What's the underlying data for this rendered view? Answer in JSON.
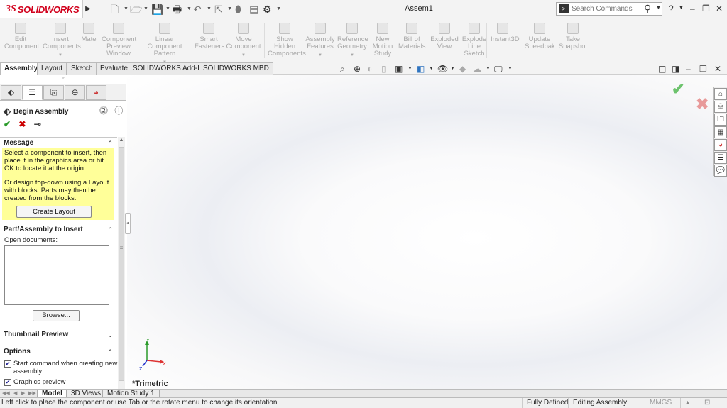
{
  "app": {
    "brand_mark": "3S",
    "brand_name": "SOLIDWORKS",
    "document_title": "Assem1"
  },
  "title_bar": {
    "search_placeholder": "Search Commands",
    "help_label": "?",
    "minimize_label": "–",
    "restore_label": "❐",
    "close_label": "✕"
  },
  "ribbon": {
    "commands": [
      {
        "id": "edit-component",
        "label": "Edit Component",
        "lines": [
          "Edit",
          "Component"
        ],
        "has_dropdown": false
      },
      {
        "id": "insert-components",
        "label": "Insert Components",
        "lines": [
          "Insert",
          "Components"
        ],
        "has_dropdown": true
      },
      {
        "id": "mate",
        "label": "Mate",
        "lines": [
          "Mate"
        ],
        "has_dropdown": false
      },
      {
        "id": "component-preview-window",
        "label": "Component Preview Window",
        "lines": [
          "Component",
          "Preview",
          "Window"
        ],
        "has_dropdown": false
      },
      {
        "id": "linear-component-pattern",
        "label": "Linear Component Pattern",
        "lines": [
          "Linear Component",
          "Pattern"
        ],
        "has_dropdown": true
      },
      {
        "id": "smart-fasteners",
        "label": "Smart Fasteners",
        "lines": [
          "Smart",
          "Fasteners"
        ],
        "has_dropdown": false
      },
      {
        "id": "move-component",
        "label": "Move Component",
        "lines": [
          "Move",
          "Component"
        ],
        "has_dropdown": true
      },
      {
        "id": "show-hidden-components",
        "label": "Show Hidden Components",
        "lines": [
          "Show",
          "Hidden",
          "Components"
        ],
        "has_dropdown": false
      },
      {
        "id": "assembly-features",
        "label": "Assembly Features",
        "lines": [
          "Assembly",
          "Features"
        ],
        "has_dropdown": true
      },
      {
        "id": "reference-geometry",
        "label": "Reference Geometry",
        "lines": [
          "Reference",
          "Geometry"
        ],
        "has_dropdown": true
      },
      {
        "id": "new-motion-study",
        "label": "New Motion Study",
        "lines": [
          "New",
          "Motion",
          "Study"
        ],
        "has_dropdown": false
      },
      {
        "id": "bill-of-materials",
        "label": "Bill of Materials",
        "lines": [
          "Bill of",
          "Materials"
        ],
        "has_dropdown": false
      },
      {
        "id": "exploded-view",
        "label": "Exploded View",
        "lines": [
          "Exploded",
          "View"
        ],
        "has_dropdown": false
      },
      {
        "id": "explode-line-sketch",
        "label": "Explode Line Sketch",
        "lines": [
          "Explode",
          "Line",
          "Sketch"
        ],
        "has_dropdown": false
      },
      {
        "id": "instant3d",
        "label": "Instant3D",
        "lines": [
          "Instant3D"
        ],
        "has_dropdown": false
      },
      {
        "id": "update-speedpak",
        "label": "Update Speedpak",
        "lines": [
          "Update",
          "Speedpak"
        ],
        "has_dropdown": false
      },
      {
        "id": "take-snapshot",
        "label": "Take Snapshot",
        "lines": [
          "Take",
          "Snapshot"
        ],
        "has_dropdown": false
      }
    ]
  },
  "command_tabs": [
    "Assembly",
    "Layout",
    "Sketch",
    "Evaluate",
    "SOLIDWORKS Add-Ins",
    "SOLIDWORKS MBD"
  ],
  "command_tabs_active": "Assembly",
  "property_manager": {
    "title": "Begin Assembly",
    "ok_label": "✔",
    "cancel_label": "✖",
    "pin_label": "⊸",
    "message": {
      "header": "Message",
      "line1": "Select a component to insert, then place it in the graphics area or hit OK to locate it at the origin.",
      "line2": "Or design top-down using a Layout with blocks. Parts may then be created from the blocks.",
      "create_layout_label": "Create Layout"
    },
    "part_assembly": {
      "header": "Part/Assembly to Insert",
      "open_documents_label": "Open documents:",
      "open_documents": [],
      "browse_label": "Browse..."
    },
    "thumbnail_preview": {
      "header": "Thumbnail Preview"
    },
    "options": {
      "header": "Options",
      "start_command": {
        "label": "Start command when creating new assembly",
        "checked": true
      },
      "graphics_preview": {
        "label": "Graphics preview",
        "checked": true
      }
    }
  },
  "graphics": {
    "view_orientation": "*Trimetric",
    "triad": {
      "x": "X",
      "y": "Y",
      "z": "Z"
    }
  },
  "bottom_tabs": [
    "Model",
    "3D Views",
    "Motion Study 1"
  ],
  "bottom_tabs_active": "Model",
  "status_bar": {
    "message": "Left click to place the component or use Tab or the rotate menu to change its orientation",
    "definition_state": "Fully Defined",
    "editing_mode": "Editing Assembly",
    "unit_system": "MMGS"
  },
  "colors": {
    "brand": "#d1001c",
    "message_background": "#ffff99",
    "ok_green": "#6dc36d",
    "cancel_red": "#e89a9a"
  }
}
